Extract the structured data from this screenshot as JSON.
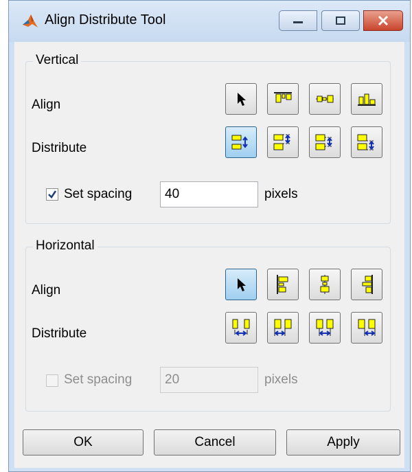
{
  "window": {
    "title": "Align Distribute Tool"
  },
  "vertical": {
    "title": "Vertical",
    "align_label": "Align",
    "distribute_label": "Distribute",
    "spacing": {
      "checked": true,
      "label": "Set spacing",
      "value": "40",
      "unit": "pixels"
    }
  },
  "horizontal": {
    "title": "Horizontal",
    "align_label": "Align",
    "distribute_label": "Distribute",
    "spacing": {
      "checked": false,
      "label": "Set spacing",
      "value": "20",
      "unit": "pixels",
      "disabled": true
    }
  },
  "buttons": {
    "ok": "OK",
    "cancel": "Cancel",
    "apply": "Apply"
  },
  "colors": {
    "icon_fill": "#ffff00",
    "icon_stroke": "#222222",
    "arrow": "#1030b0",
    "pressed_bg": "#9fcff0",
    "title_bar": "#c7daf0",
    "close": "#c9452c"
  }
}
